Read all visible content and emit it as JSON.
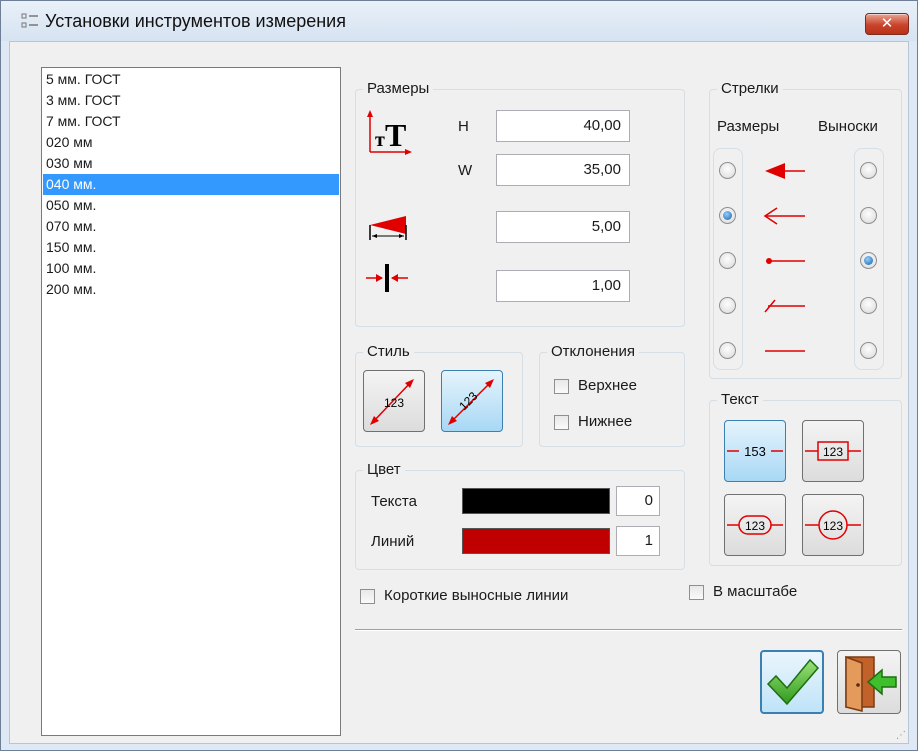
{
  "window": {
    "title": "Установки инструментов измерения",
    "close_icon": "close-icon"
  },
  "list": {
    "items": [
      "5 мм. ГОСТ",
      "3 мм. ГОСТ",
      "7 мм. ГОСТ",
      "020 мм",
      "030 мм",
      "040 мм.",
      "050 мм.",
      "070 мм.",
      "150 мм.",
      "100 мм.",
      "200 мм."
    ],
    "selected": "040 мм."
  },
  "sizes": {
    "label": "Размеры",
    "h_label": "H",
    "w_label": "W",
    "h_value": "40,00",
    "w_value": "35,00",
    "arrow_size_value": "5,00",
    "gap_value": "1,00"
  },
  "style": {
    "label": "Стиль"
  },
  "tolerances": {
    "label": "Отклонения",
    "upper": "Верхнее",
    "lower": "Нижнее"
  },
  "color": {
    "label": "Цвет",
    "text_label": "Текста",
    "lines_label": "Линий",
    "text_color": "#000000",
    "lines_color": "#c00000",
    "text_index": "0",
    "lines_index": "1"
  },
  "arrows": {
    "label": "Стрелки",
    "dims_header": "Размеры",
    "leaders_header": "Выноски",
    "dims_selected_index": 1,
    "leaders_selected_index": 2,
    "accent": "#e00000"
  },
  "text_section": {
    "label": "Текст",
    "sample_1": "153",
    "sample_2": "123",
    "sample_3": "123",
    "sample_4": "123"
  },
  "options": {
    "short_extension_lines": "Короткие выносные линии",
    "to_scale": "В масштабе"
  },
  "buttons": {
    "ok_icon": "checkmark-icon",
    "exit_icon": "exit-door-icon"
  },
  "style_samples": {
    "sample_1": "123",
    "sample_2": "123"
  }
}
